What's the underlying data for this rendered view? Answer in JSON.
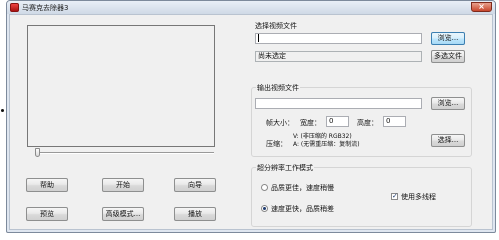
{
  "window": {
    "title": "马赛克去除器3",
    "close_glyph": "×"
  },
  "player": {
    "buttons": {
      "help": "帮助",
      "start": "开始",
      "wizard": "向导",
      "preview": "预览",
      "advanced": "高级模式...",
      "play": "播放"
    }
  },
  "input_video": {
    "label": "选择视频文件",
    "path_value": "",
    "status": "尚未选定",
    "browse_button": "浏览...",
    "multi_select_button": "多选文件"
  },
  "output_video": {
    "label": "输出视频文件",
    "path_value": "",
    "browse_button": "浏览...",
    "frame_size_label": "帧大小：",
    "width_label": "宽度：",
    "width_value": "0",
    "height_label": "高度：",
    "height_value": "0",
    "compression_label": "压缩：",
    "compression_video": "V: (非压缩的 RGB32)",
    "compression_audio": "A: (无需重压缩：复制流)",
    "select_button": "选择..."
  },
  "super_resolution": {
    "label": "超分辨率工作模式",
    "options": [
      {
        "label": "品质更佳，速度稍慢",
        "checked": false
      },
      {
        "label": "速度更快，品质稍差",
        "checked": true
      }
    ],
    "multithread": {
      "label": "使用多线程",
      "checked": true,
      "glyph": "✓"
    }
  }
}
